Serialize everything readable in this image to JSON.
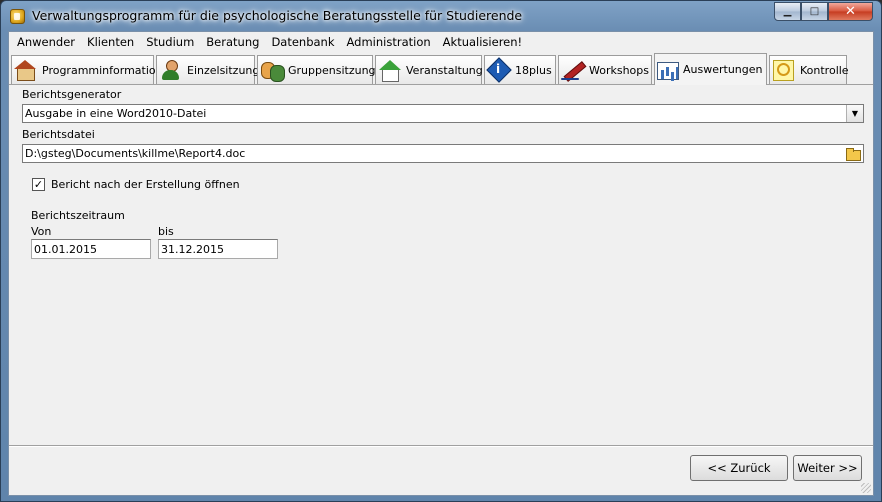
{
  "window": {
    "title": "Verwaltungsprogramm für die psychologische Beratungsstelle für Studierende"
  },
  "menu": [
    {
      "label": "Anwender"
    },
    {
      "label": "Klienten"
    },
    {
      "label": "Studium"
    },
    {
      "label": "Beratung"
    },
    {
      "label": "Datenbank"
    },
    {
      "label": "Administration"
    },
    {
      "label": "Aktualisieren!"
    }
  ],
  "tabs": [
    {
      "label": "Programminformation",
      "icon": "house-icon"
    },
    {
      "label": "Einzelsitzung",
      "icon": "person-icon"
    },
    {
      "label": "Gruppensitzung",
      "icon": "group-icon"
    },
    {
      "label": "Veranstaltung",
      "icon": "house-green-icon"
    },
    {
      "label": "18plus",
      "icon": "info-diamond-icon"
    },
    {
      "label": "Workshops",
      "icon": "pencil-icon"
    },
    {
      "label": "Auswertungen",
      "icon": "chart-icon",
      "active": true
    },
    {
      "label": "Kontrolle",
      "icon": "magnifier-icon"
    }
  ],
  "report": {
    "generator_label": "Berichtsgenerator",
    "generator_value": "Ausgabe in eine Word2010-Datei",
    "file_label": "Berichtsdatei",
    "file_value": "D:\\gsteg\\Documents\\killme\\Report4.doc",
    "open_after_label": "Bericht nach der Erstellung öffnen",
    "open_after_checked": true,
    "period_label": "Berichtszeitraum",
    "from_label": "Von",
    "from_value": "01.01.2015",
    "to_label": "bis",
    "to_value": "31.12.2015"
  },
  "buttons": {
    "back": "<< Zurück",
    "next": "Weiter >>"
  }
}
